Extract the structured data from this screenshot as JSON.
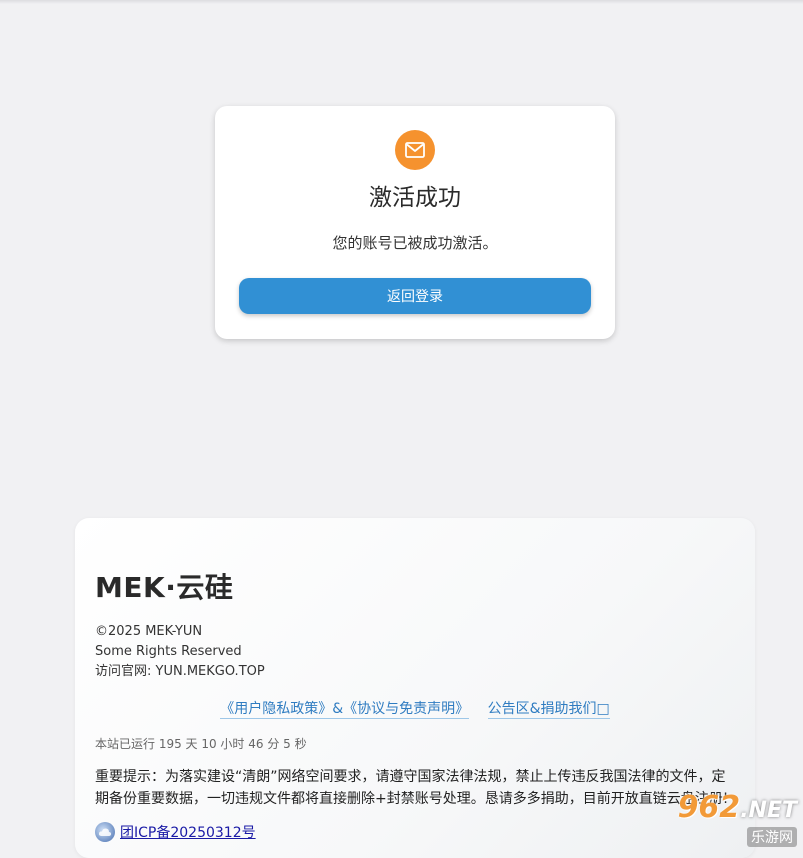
{
  "card": {
    "icon": "mail-icon",
    "title": "激活成功",
    "message": "您的账号已被成功激活。",
    "button_label": "返回登录"
  },
  "footer": {
    "brand": "MEK·云硅",
    "copyright": "©2025 MEK-YUN",
    "rights": "Some Rights Reserved",
    "site": "访问官网: YUN.MEKGO.TOP",
    "links": {
      "policy": "《用户隐私政策》&《协议与免责声明》",
      "board": "公告区&捐助我们□"
    },
    "uptime": "本站已运行 195 天 10 小时 46 分 5 秒",
    "notice": "重要提示：为落实建设“清朗”网络空间要求，请遵守国家法律法规，禁止上传违反我国法律的文件，定期备份重要数据，一切违规文件都将直接删除+封禁账号处理。恳请多多捐助，目前开放直链云盘注册!",
    "icp": "团ICP备20250312号"
  },
  "watermark": {
    "number": "962",
    "domain": ".NET",
    "subtitle": "乐游网"
  },
  "colors": {
    "accent": "#3190d4",
    "icon_badge": "#f5922e",
    "background": "#f1f1f3"
  }
}
